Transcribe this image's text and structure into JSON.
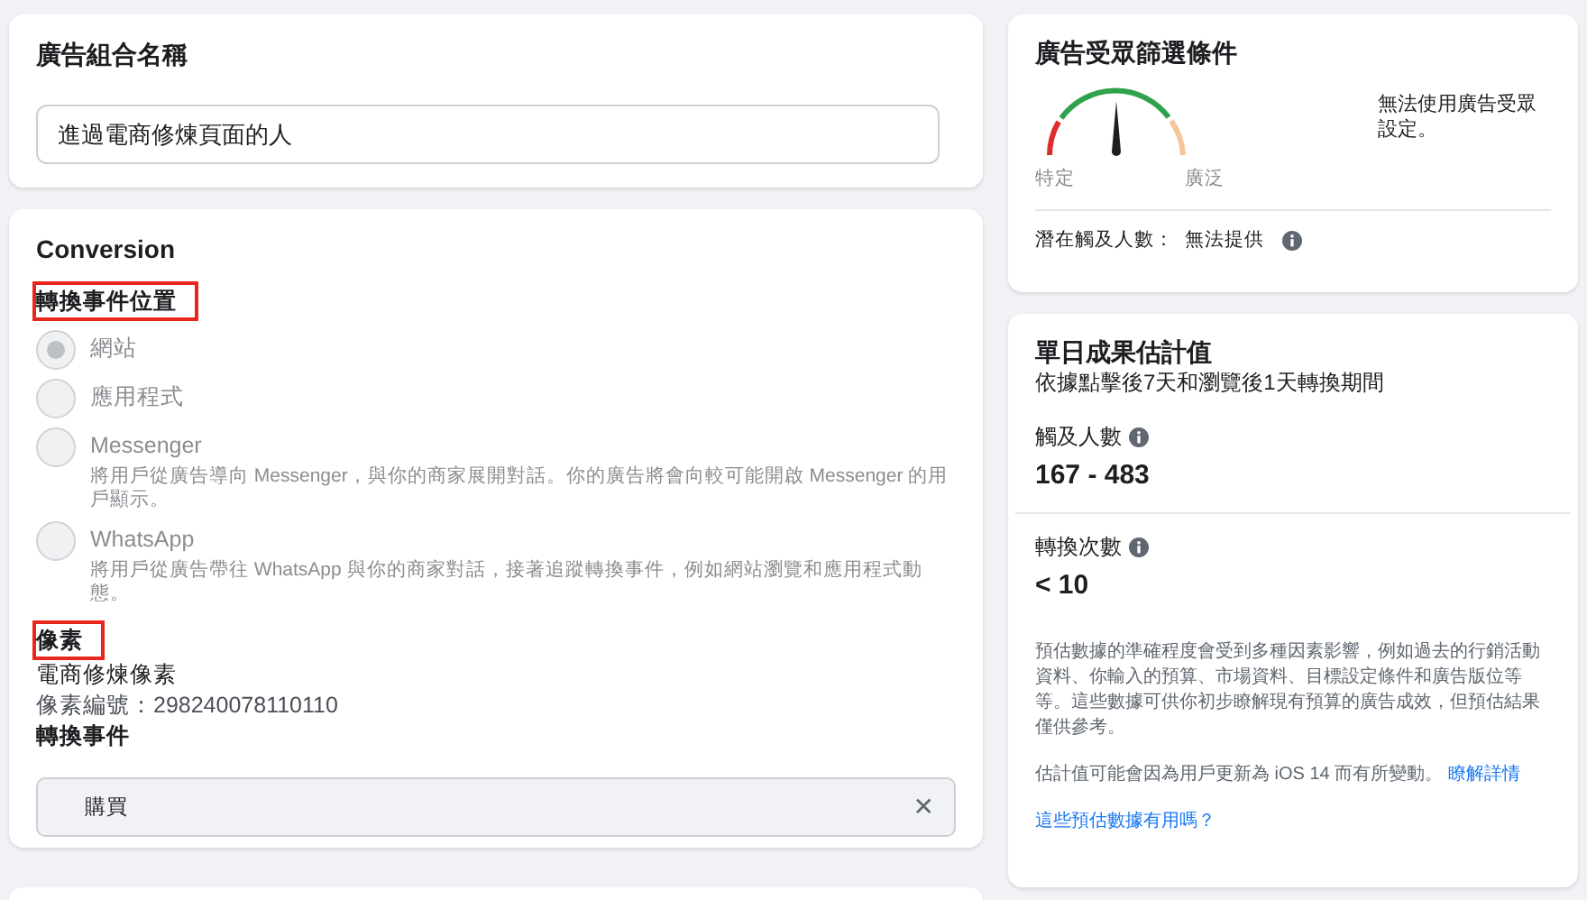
{
  "ad_set_name": {
    "title": "廣告組合名稱",
    "value": "進過電商修煉頁面的人"
  },
  "conversion": {
    "title": "Conversion",
    "location_heading": {
      "text": "轉換事件位置",
      "highlighted": true
    },
    "options": [
      {
        "label": "網站",
        "selected": true,
        "disabled": true
      },
      {
        "label": "應用程式",
        "selected": false,
        "disabled": true
      },
      {
        "label": "Messenger",
        "selected": false,
        "disabled": true,
        "description": "將用戶從廣告導向 Messenger，與你的商家展開對話。你的廣告將會向較可能開啟 Messenger 的用戶顯示。"
      },
      {
        "label": "WhatsApp",
        "selected": false,
        "disabled": true,
        "description": "將用戶從廣告帶往 WhatsApp 與你的商家對話，接著追蹤轉換事件，例如網站瀏覽和應用程式動態。"
      }
    ],
    "pixel_heading": {
      "text": "像素",
      "highlighted": true
    },
    "pixel_name": "電商修煉像素",
    "pixel_id": "像素編號：298240078110110",
    "event_heading": "轉換事件",
    "event_value": "購買",
    "clear_glyph": "✕"
  },
  "audience": {
    "title": "廣告受眾篩選條件",
    "gauge": {
      "level": 0.5,
      "left_label": "特定",
      "right_label": "廣泛"
    },
    "message": "無法使用廣告受眾設定。",
    "potential_label": "潛在觸及人數：",
    "potential_value": "無法提供"
  },
  "estimates": {
    "title": "單日成果估計值",
    "subtitle": "依據點擊後7天和瀏覽後1天轉換期間",
    "metrics": [
      {
        "label": "觸及人數",
        "value": "167 - 483"
      },
      {
        "label": "轉換次數",
        "value": "< 10"
      }
    ],
    "disclaimer": "預估數據的準確程度會受到多種因素影響，例如過去的行銷活動資料、你輸入的預算、市場資料、目標設定條件和廣告版位等等。這些數據可供你初步瞭解現有預算的廣告成效，但預估結果僅供參考。",
    "ios_note": "估計值可能會因為用戶更新為 iOS 14 而有所變動。",
    "learn_more": "瞭解詳情",
    "feedback_link": "這些預估數據有用嗎？"
  }
}
